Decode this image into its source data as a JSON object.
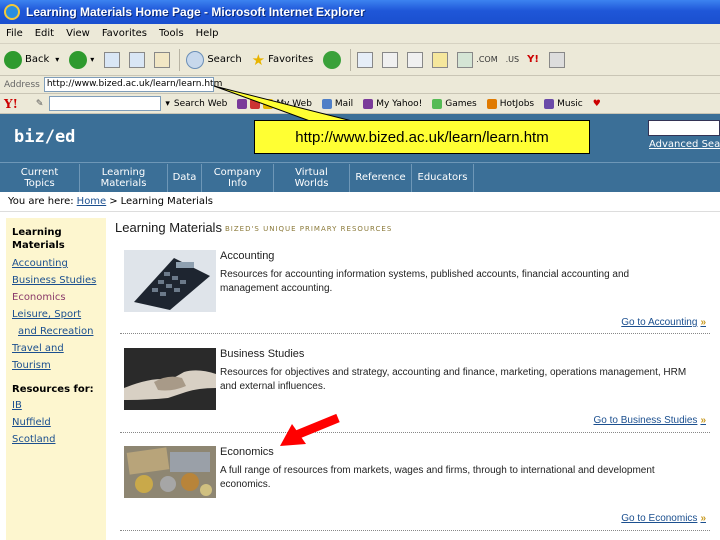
{
  "window": {
    "title": "Learning Materials Home Page - Microsoft Internet Explorer"
  },
  "menu": [
    "File",
    "Edit",
    "View",
    "Favorites",
    "Tools",
    "Help"
  ],
  "toolbar": {
    "back": "Back",
    "search": "Search",
    "favorites": "Favorites",
    "icon_labels": [
      ".COM",
      ".US"
    ]
  },
  "address": {
    "label": "Address",
    "value": "http://www.bized.ac.uk/learn/learn.htm"
  },
  "yahoo_toolbar": {
    "search_web": "Search Web",
    "items": [
      "My Web",
      "Mail",
      "My Yahoo!",
      "Games",
      "HotJobs",
      "Music"
    ]
  },
  "bized": {
    "logo": "biz/ed",
    "advanced_search": "Advanced Search",
    "nav": [
      "Current Topics",
      "Learning Materials",
      "Data",
      "Company Info",
      "Virtual Worlds",
      "Reference",
      "Educators"
    ]
  },
  "breadcrumb": {
    "prefix": "You are here:",
    "home": "Home",
    "separator": ">",
    "current": "Learning Materials"
  },
  "sidebar": {
    "heading": "Learning Materials",
    "links": [
      "Accounting",
      "Business Studies",
      "Economics",
      "Leisure, Sport",
      "and Recreation",
      "Travel and",
      "Tourism"
    ],
    "resources_heading": "Resources for:",
    "resources": [
      "IB",
      "Nuffield",
      "Scotland"
    ]
  },
  "main": {
    "title": "Learning Materials",
    "subtitle": "BIZED'S UNIQUE PRIMARY RESOURCES",
    "sections": [
      {
        "title": "Accounting",
        "description": "Resources for accounting information systems, published accounts, financial accounting and management accounting.",
        "link": "Go to Accounting"
      },
      {
        "title": "Business Studies",
        "description": "Resources for objectives and strategy, accounting and finance, marketing, operations management, HRM and external influences.",
        "link": "Go to Business Studies"
      },
      {
        "title": "Economics",
        "description": "A full range of resources from markets, wages and firms, through to international and development economics.",
        "link": "Go to Economics"
      }
    ]
  },
  "callout": {
    "text": "http://www.bized.ac.uk/learn/learn.htm"
  },
  "colors": {
    "header_blue": "#3b6f97",
    "sidebar_yellow": "#fdf6cf",
    "callout_yellow": "#ffff33",
    "arrow_red": "#ff0000",
    "link_blue": "#1b4f8f"
  }
}
